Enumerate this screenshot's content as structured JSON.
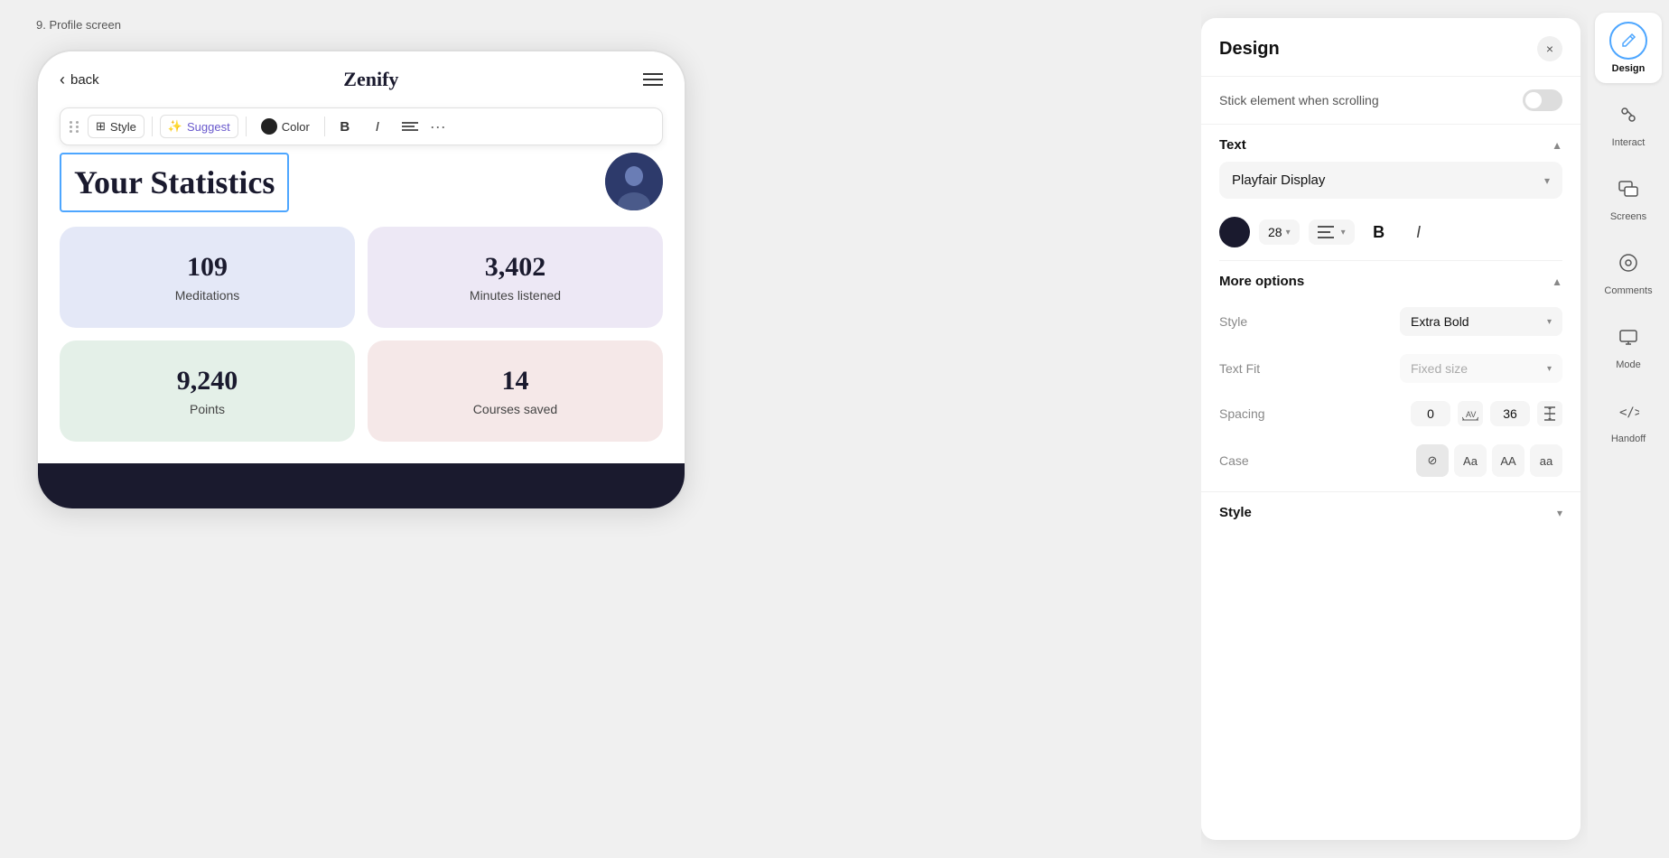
{
  "page": {
    "label": "9. Profile screen"
  },
  "phone": {
    "back_label": "back",
    "app_title": "Zenify",
    "toolbar": {
      "style_label": "Style",
      "suggest_label": "Suggest",
      "color_label": "Color",
      "bold_label": "B",
      "italic_label": "I"
    },
    "heading": "Your Statistics",
    "stats": [
      {
        "number": "109",
        "label": "Meditations",
        "color_class": "stat-card-blue"
      },
      {
        "number": "3,402",
        "label": "Minutes listened",
        "color_class": "stat-card-purple"
      },
      {
        "number": "9,240",
        "label": "Points",
        "color_class": "stat-card-green"
      },
      {
        "number": "14",
        "label": "Courses saved",
        "color_class": "stat-card-pink"
      }
    ]
  },
  "design_panel": {
    "title": "Design",
    "close_label": "×",
    "sticky_label": "Stick element when scrolling",
    "text_section": {
      "label": "Text"
    },
    "font": {
      "name": "Playfair Display"
    },
    "font_size": "28",
    "bold_label": "B",
    "italic_label": "I",
    "more_options": {
      "label": "More options"
    },
    "style_option": {
      "label": "Style",
      "value": "Extra Bold"
    },
    "text_fit_option": {
      "label": "Text Fit",
      "value": "Fixed size"
    },
    "spacing": {
      "label": "Spacing",
      "letter_value": "0",
      "line_value": "36"
    },
    "case": {
      "label": "Case",
      "options": [
        {
          "label": "⊘",
          "type": "none"
        },
        {
          "label": "Aa",
          "type": "title"
        },
        {
          "label": "AA",
          "type": "upper"
        },
        {
          "label": "aa",
          "type": "lower"
        }
      ]
    },
    "bottom_style": {
      "label": "Style"
    }
  },
  "right_sidebar": {
    "items": [
      {
        "id": "design",
        "label": "Design",
        "icon": "✏️",
        "active": true
      },
      {
        "id": "interact",
        "label": "Interact",
        "icon": "🔗",
        "active": false
      },
      {
        "id": "screens",
        "label": "Screens",
        "icon": "🗂",
        "active": false
      },
      {
        "id": "comments",
        "label": "Comments",
        "icon": "💬",
        "active": false
      },
      {
        "id": "mode",
        "label": "Mode",
        "icon": "🖥",
        "active": false
      },
      {
        "id": "handoff",
        "label": "Handoff",
        "icon": "</>",
        "active": false
      }
    ]
  }
}
